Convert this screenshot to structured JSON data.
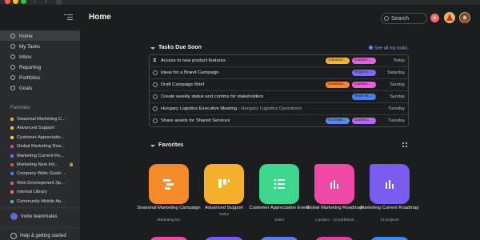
{
  "header": {
    "title": "Home",
    "search_label": "Search"
  },
  "sidebar": {
    "items": [
      {
        "label": "Home",
        "icon": "home-icon",
        "active": true
      },
      {
        "label": "My Tasks",
        "icon": "check-circle-icon"
      },
      {
        "label": "Inbox",
        "icon": "bell-icon"
      },
      {
        "label": "Reporting",
        "icon": "chart-icon"
      },
      {
        "label": "Portfolios",
        "icon": "folder-icon"
      },
      {
        "label": "Goals",
        "icon": "person-icon"
      }
    ],
    "favorites_label": "Favorites",
    "favorites": [
      {
        "label": "Seasonal Marketing C...",
        "color": "#f0a030"
      },
      {
        "label": "Advanced Support",
        "color": "#f2b43a"
      },
      {
        "label": "Customer Appreciatio...",
        "color": "#f5c84a"
      },
      {
        "label": "Global Marketing Roa...",
        "color": "#e0409a"
      },
      {
        "label": "Marketing Current Ro...",
        "color": "#8b5cf6"
      },
      {
        "label": "Marketing New Init...",
        "color": "#e04a4a",
        "locked": true
      },
      {
        "label": "Company Wide Goals ...",
        "color": "#4c7ef0"
      },
      {
        "label": "Web Development Sp...",
        "color": "#e04aa0"
      },
      {
        "label": "Internal Library",
        "color": "#f06a6a"
      },
      {
        "label": "Community Mobile Ap...",
        "color": "#3ab8a8"
      }
    ],
    "invite_label": "Invite teammates",
    "help_label": "Help & getting started"
  },
  "tasks": {
    "title": "Tasks Due Soon",
    "see_all": "See all my tasks",
    "rows": [
      {
        "name": "Access to new product features",
        "sub": "",
        "pills": [
          {
            "text": "Advance...",
            "color": "#f2b43a"
          },
          {
            "text": "Custom...",
            "color": "#e064d6"
          }
        ],
        "due": "Today",
        "icon": "hourglass-icon"
      },
      {
        "name": "Ideas for a Brand Campaign",
        "sub": "",
        "pills": [
          {
            "text": "Project I...",
            "color": "#7a6cf0"
          }
        ],
        "due": "Saturday",
        "icon": "check-circle-icon"
      },
      {
        "name": "Draft Campaign Brief",
        "sub": "",
        "pills": [
          {
            "text": "Seasona...",
            "color": "#f08a3a"
          },
          {
            "text": "Custom...",
            "color": "#e064d6"
          }
        ],
        "due": "Sunday",
        "icon": "check-circle-icon"
      },
      {
        "name": "Create weekly status and comms for stakeholders",
        "sub": "",
        "pills": [
          {
            "text": "Team W...",
            "color": "#4c7ef0"
          }
        ],
        "due": "Sunday",
        "icon": "check-circle-icon"
      },
      {
        "name": "Hungary Logistics Executive Meeting",
        "sub": "› Hungary Logistics Operations",
        "pills": [],
        "due": "Tuesday",
        "icon": "check-circle-icon"
      },
      {
        "name": "Share assets for Shared Services",
        "sub": "",
        "pills": [
          {
            "text": "Increase...",
            "color": "#5e86f0"
          },
          {
            "text": "Custom...",
            "color": "#b06cf0"
          }
        ],
        "due": "Tuesday",
        "icon": "check-circle-icon"
      }
    ]
  },
  "favorites_section": {
    "title": "Favorites",
    "tiles": [
      {
        "label": "Seasonal Marketing Campaign",
        "sub": "Marketing NA",
        "color": "#f58a2a",
        "glyph": "timeline-icon"
      },
      {
        "label": "Advanced Support",
        "sub": "Sales",
        "color": "#f5b02a",
        "glyph": "board-icon"
      },
      {
        "label": "Customer Appreciation Event",
        "sub": "Sales",
        "color": "#3dd68c",
        "glyph": "list-icon"
      },
      {
        "label": "Global Marketing Roadmap",
        "sub": "1 project · 10 portfolios",
        "color": "#f04aa8",
        "glyph": "portfolio-chart-icon"
      },
      {
        "label": "Marketing Current Roadmap",
        "sub": "13 projects",
        "color": "#7a5cf0",
        "glyph": "portfolio-chart-icon"
      }
    ],
    "bottom_row_colors": [
      "#f04aa8",
      "#7a5cf0",
      "#5a7cf0",
      "#e040a0",
      "#3a8cf0"
    ]
  },
  "colors": {
    "accent": "#f06a6a",
    "sidebar_bg": "#2a2b2e",
    "main_bg": "#1c1d1f"
  }
}
